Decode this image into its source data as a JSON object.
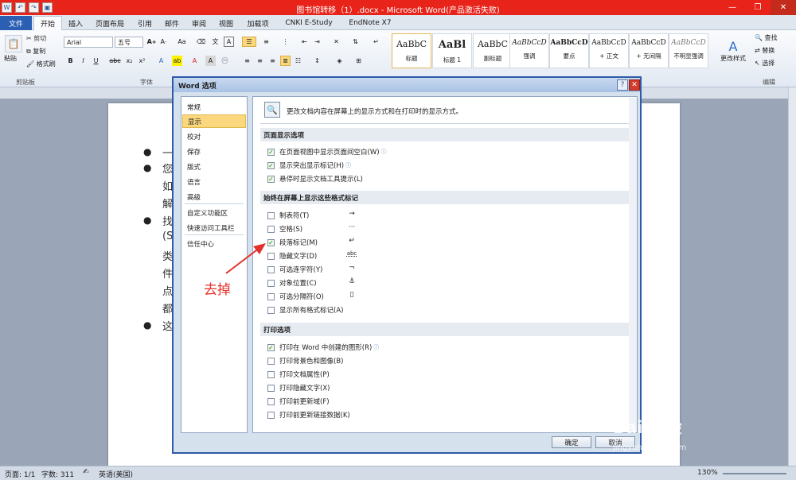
{
  "window": {
    "title": "图书馆转移（1）.docx - Microsoft Word(产品激活失败)"
  },
  "tabs": [
    "文件",
    "开始",
    "插入",
    "页面布局",
    "引用",
    "邮件",
    "审阅",
    "视图",
    "加载项",
    "CNKI E-Study",
    "EndNote X7"
  ],
  "ribbon": {
    "clipboard": {
      "paste": "粘贴",
      "cut": "剪切",
      "copy": "复制",
      "painter": "格式刷",
      "label": "剪贴板"
    },
    "font": {
      "name": "Arial",
      "size": "五号",
      "label": "字体"
    },
    "paragraph_label": "段落",
    "styles": [
      {
        "sample": "AaBbC",
        "name": "标题"
      },
      {
        "sample": "AaBl",
        "name": "标题 1"
      },
      {
        "sample": "AaBbC",
        "name": "副标题"
      },
      {
        "sample": "AaBbCcD",
        "name": "强调"
      },
      {
        "sample": "AaBbCcD",
        "name": "要点"
      },
      {
        "sample": "AaBbCcD",
        "name": "+ 正文"
      },
      {
        "sample": "AaBbCcD",
        "name": "+ 无间隔"
      },
      {
        "sample": "AaBbCcD",
        "name": "不明显强调"
      }
    ],
    "change_styles": "更改样式",
    "styles_label": "样式",
    "editing": {
      "find": "查找",
      "replace": "替换",
      "select": "选择",
      "label": "编辑"
    }
  },
  "document": {
    "bullets": [
      "一",
      "您",
      "如",
      "解",
      "找",
      "(S",
      "类",
      "件",
      "点",
      "都",
      "这"
    ]
  },
  "dialog": {
    "title": "Word 选项",
    "nav": [
      "常规",
      "显示",
      "校对",
      "保存",
      "版式",
      "语言",
      "高级",
      "自定义功能区",
      "快速访问工具栏",
      "信任中心"
    ],
    "selected_nav": "显示",
    "header": "更改文档内容在屏幕上的显示方式和在打印时的显示方式。",
    "page_display": {
      "heading": "页面显示选项",
      "items": [
        {
          "label": "在页面视图中显示页面间空白(W)",
          "checked": true
        },
        {
          "label": "显示突出显示标记(H)",
          "checked": true
        },
        {
          "label": "悬停时显示文档工具提示(L)",
          "checked": true
        }
      ]
    },
    "format_marks": {
      "heading": "始终在屏幕上显示这些格式标记",
      "items": [
        {
          "label": "制表符(T)",
          "checked": false,
          "mark": "→"
        },
        {
          "label": "空格(S)",
          "checked": false,
          "mark": "···"
        },
        {
          "label": "段落标记(M)",
          "checked": true,
          "mark": "↵"
        },
        {
          "label": "隐藏文字(D)",
          "checked": false,
          "mark": "abc"
        },
        {
          "label": "可选连字符(Y)",
          "checked": false,
          "mark": "¬"
        },
        {
          "label": "对象位置(C)",
          "checked": false,
          "mark": "⚓"
        },
        {
          "label": "可选分隔符(O)",
          "checked": false,
          "mark": "▯"
        },
        {
          "label": "显示所有格式标记(A)",
          "checked": false,
          "mark": ""
        }
      ]
    },
    "print": {
      "heading": "打印选项",
      "items": [
        {
          "label": "打印在 Word 中创建的图形(R)",
          "checked": true
        },
        {
          "label": "打印背景色和图像(B)",
          "checked": false
        },
        {
          "label": "打印文档属性(P)",
          "checked": false
        },
        {
          "label": "打印隐藏文字(X)",
          "checked": false
        },
        {
          "label": "打印前更新域(F)",
          "checked": false
        },
        {
          "label": "打印前更新链接数据(K)",
          "checked": false
        }
      ]
    },
    "ok": "确定",
    "cancel": "取消"
  },
  "annotation": "去掉",
  "statusbar": {
    "page": "页面: 1/1",
    "words": "字数: 311",
    "lang": "英语(美国)",
    "zoom": "130%"
  },
  "watermark": {
    "text": "Bai 经验",
    "url": "jingyan.baidu.com"
  }
}
